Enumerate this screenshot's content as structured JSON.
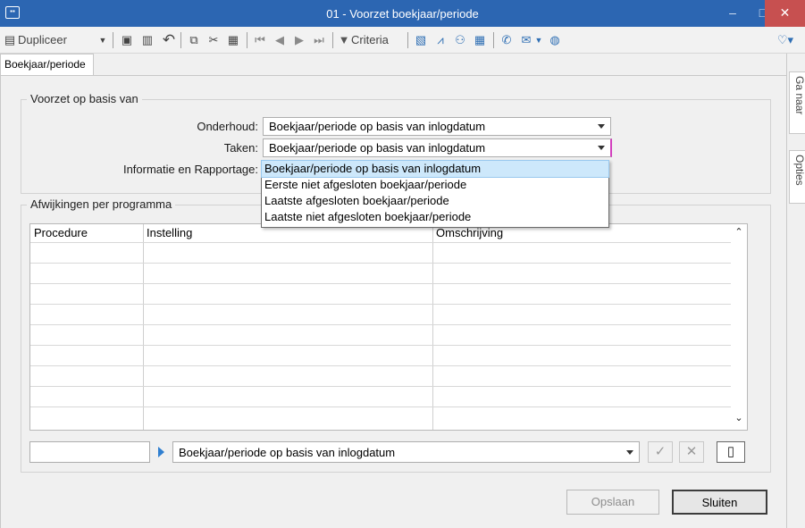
{
  "window": {
    "title": "01 - Voorzet boekjaar/periode",
    "min_glyph": "–",
    "max_glyph": "□",
    "close_glyph": "✕"
  },
  "toolbar": {
    "duplicate_label": "Dupliceer",
    "criteria_label": "Criteria"
  },
  "tabs": [
    {
      "label": "Boekjaar/periode"
    }
  ],
  "side_tabs": [
    {
      "label": "Ga naar"
    },
    {
      "label": "Opties"
    }
  ],
  "group_voorzet": {
    "legend": "Voorzet op basis van",
    "rows": [
      {
        "label": "Onderhoud:",
        "value": "Boekjaar/periode op basis van inlogdatum"
      },
      {
        "label": "Taken:",
        "value": "Boekjaar/periode op basis van inlogdatum"
      },
      {
        "label": "Informatie en Rapportage:",
        "value": ""
      }
    ]
  },
  "dropdown": {
    "options": [
      "Boekjaar/periode op basis van inlogdatum",
      "Eerste niet afgesloten boekjaar/periode",
      "Laatste afgesloten boekjaar/periode",
      "Laatste niet afgesloten boekjaar/periode"
    ],
    "selected_index": 0
  },
  "group_afwijkingen": {
    "legend": "Afwijkingen per programma",
    "columns": [
      "Procedure",
      "Instelling",
      "Omschrijving"
    ]
  },
  "editor": {
    "procedure_value": "",
    "instelling_value": "Boekjaar/periode op basis van inlogdatum"
  },
  "buttons": {
    "save": "Opslaan",
    "close": "Sluiten"
  },
  "colors": {
    "titlebar": "#2c66b2",
    "close_button": "#c75050",
    "selection": "#cde8fb",
    "focus_marker": "#d23fbd"
  }
}
